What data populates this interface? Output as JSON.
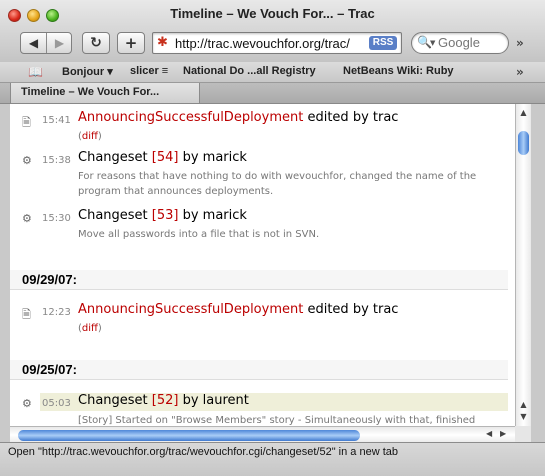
{
  "window": {
    "title": "Timeline – We Vouch For... – Trac"
  },
  "toolbar": {
    "back_icon": "◀",
    "forward_icon": "▶",
    "reload_icon": "↻",
    "add_icon": "+",
    "url": "http://trac.wevouchfor.org/trac/",
    "rss": "RSS",
    "search_placeholder": "Google",
    "overflow": "»"
  },
  "bookmarks": {
    "items": [
      {
        "label": "Bonjour ▾"
      },
      {
        "label": "slicer ≡"
      },
      {
        "label": "National Do ...all Registry"
      },
      {
        "label": "NetBeans Wiki: Ruby"
      }
    ],
    "overflow": "»"
  },
  "tabs": [
    {
      "label": "Timeline – We Vouch For..."
    }
  ],
  "timeline": {
    "entries_top": [
      {
        "icon": "page-icon",
        "time": "15:41",
        "link": "AnnouncingSuccessfulDeployment",
        "action": " edited by trac",
        "diff": "diff"
      },
      {
        "icon": "changeset-icon",
        "time": "15:38",
        "prefix": "Changeset ",
        "link": "[54]",
        "action": " by marick",
        "desc1": "For reasons that have nothing to do with wevouchfor, changed the name of the",
        "desc2": "program that announces deployments."
      },
      {
        "icon": "changeset-icon",
        "time": "15:30",
        "prefix": "Changeset ",
        "link": "[53]",
        "action": " by marick",
        "desc1": "Move all passwords into a file that is not in SVN."
      }
    ],
    "date2": "09/29/07:",
    "entry_mid": {
      "time": "12:23",
      "link": "AnnouncingSuccessfulDeployment",
      "action": " edited by trac",
      "diff": "diff"
    },
    "date3": "09/25/07:",
    "entry_bottom": {
      "time": "05:03",
      "prefix": "Changeset ",
      "link": "[52]",
      "action": " by laurent",
      "desc1": "[Story] Started on \"Browse Members\" story - Simultaneously with that, finished"
    }
  },
  "status": {
    "text": "Open \"http://trac.wevouchfor.org/trac/wevouchfor.cgi/changeset/52\" in a new tab"
  }
}
